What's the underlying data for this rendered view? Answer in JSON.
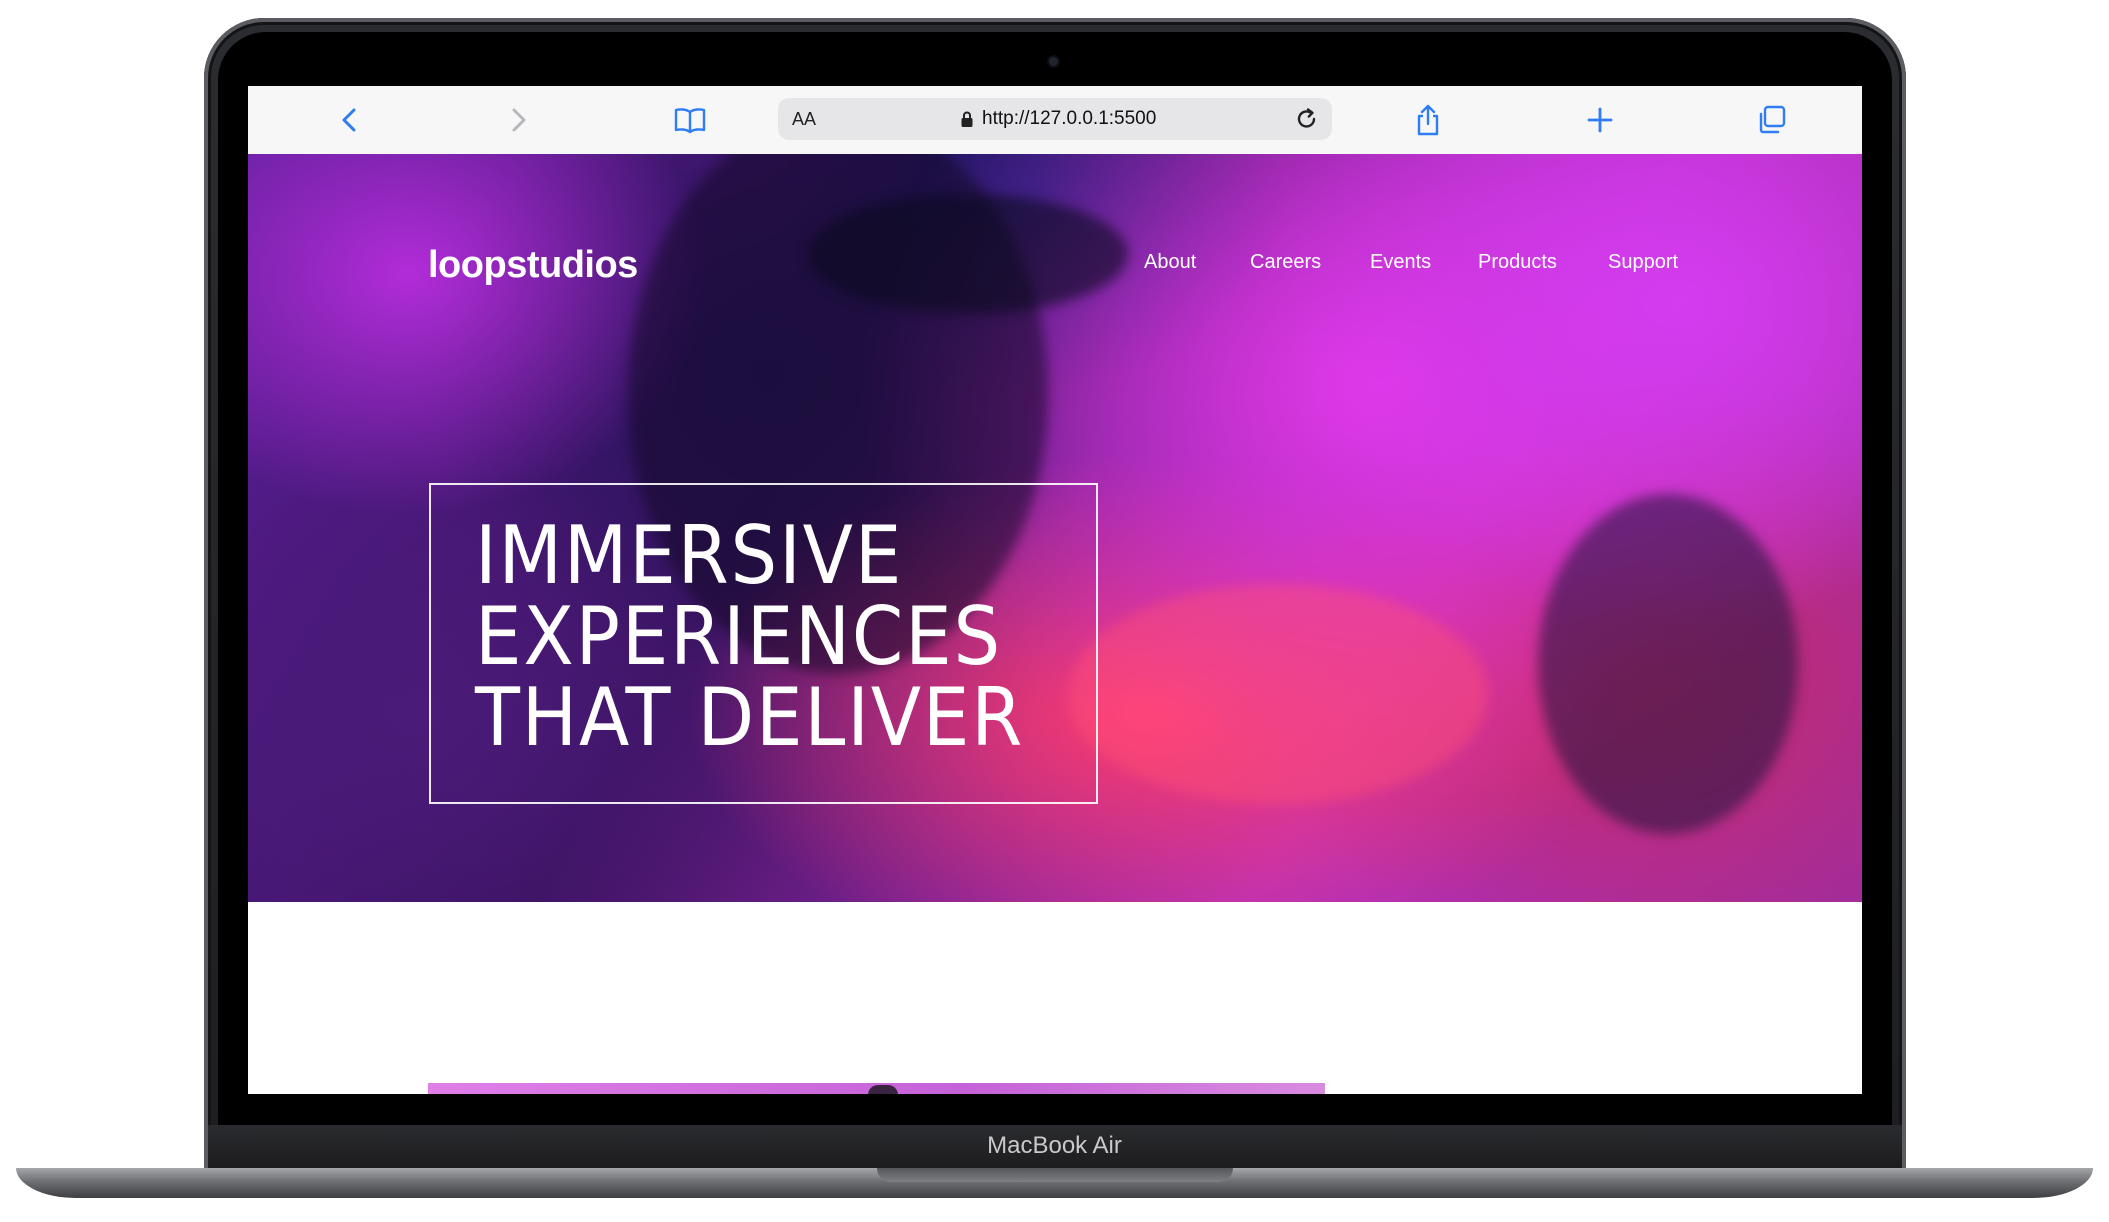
{
  "device": {
    "model_label": "MacBook Air"
  },
  "browser": {
    "text_size_label": "AA",
    "url": "http://127.0.0.1:5500",
    "icons": {
      "back": "chevron-left-icon",
      "forward": "chevron-right-icon",
      "bookmarks": "book-icon",
      "lock": "lock-icon",
      "reload": "reload-icon",
      "share": "share-icon",
      "new_tab": "plus-icon",
      "tabs": "tabs-icon"
    },
    "accent_color": "#2f7cf6"
  },
  "site": {
    "logo": "loopstudios",
    "nav": [
      "About",
      "Careers",
      "Events",
      "Products",
      "Support"
    ],
    "headline_lines": [
      "IMMERSIVE",
      "EXPERIENCES",
      "THAT DELIVER"
    ]
  }
}
